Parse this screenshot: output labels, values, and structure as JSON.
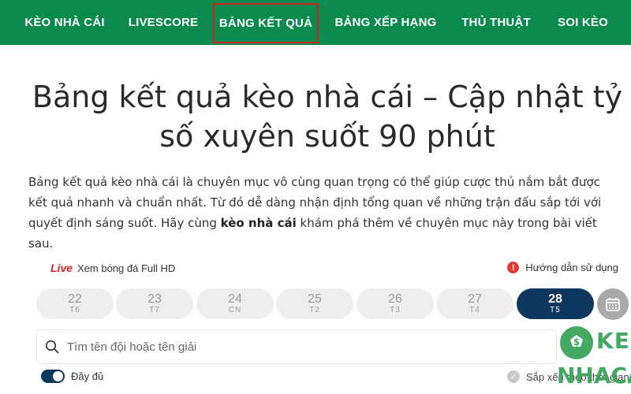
{
  "nav": {
    "items": [
      {
        "label": "KÈO NHÀ CÁI"
      },
      {
        "label": "LIVESCORE"
      },
      {
        "label": "BẢNG KẾT QUẢ"
      },
      {
        "label": "BẢNG XẾP HẠNG"
      },
      {
        "label": "THỦ THUẬT"
      },
      {
        "label": "SOI KÈO"
      }
    ],
    "active_index": 2,
    "background": "#0b8a4e",
    "highlight_border": "#d62020"
  },
  "article": {
    "title": "Bảng kết quả kèo nhà cái – Cập nhật tỷ số xuyên suốt 90 phút",
    "intro_before": "Bảng kết quả kèo nhà cái là chuyên mục vô cùng quan trọng có thể giúp cược thủ nắm bắt được kết quả nhanh và chuẩn nhất. Từ đó dễ dàng nhận định tổng quan về những trận đấu sắp tới với quyết định sáng suốt. Hãy cùng ",
    "intro_bold": "kèo nhà cái",
    "intro_after": " khám phá thêm về chuyên mục này trong bài viết sau."
  },
  "widget": {
    "live_badge": "Live",
    "live_link": "Xem bóng đá Full HD",
    "help_link": "Hướng dẫn sử dụng",
    "dates": [
      {
        "day": "22",
        "weekday": "T6"
      },
      {
        "day": "23",
        "weekday": "T7"
      },
      {
        "day": "24",
        "weekday": "CN"
      },
      {
        "day": "25",
        "weekday": "T2"
      },
      {
        "day": "26",
        "weekday": "T3"
      },
      {
        "day": "27",
        "weekday": "T4"
      },
      {
        "day": "28",
        "weekday": "T5"
      }
    ],
    "selected_date_index": 6,
    "search_placeholder": "Tìm tên đội hoặc tên giải",
    "search_value": "",
    "toggle_label": "Đầy đủ",
    "toggle_on": true,
    "sort_label": "Sắp xếp theo thời gian",
    "accent": "#0e3760"
  },
  "logo": {
    "line1": "KEO",
    "line2": "NHACAI",
    "color": "#3aa35a"
  }
}
